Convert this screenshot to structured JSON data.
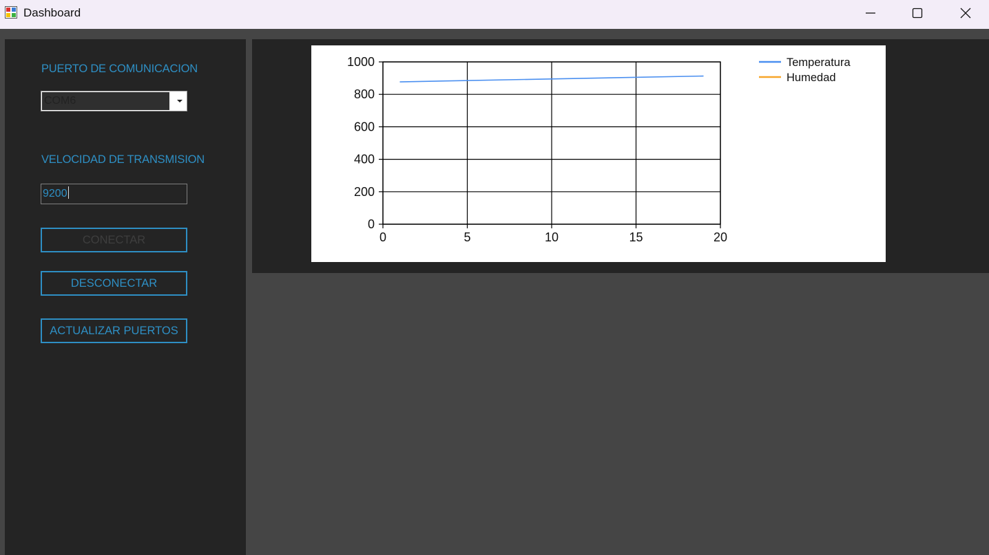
{
  "window": {
    "title": "Dashboard"
  },
  "sidebar": {
    "port_label": "PUERTO DE COMUNICACION",
    "port_value": "COM6",
    "speed_label": "VELOCIDAD DE TRANSMISION",
    "speed_value": "9200",
    "connect_label": "CONECTAR",
    "disconnect_label": "DESCONECTAR",
    "refresh_label": "ACTUALIZAR PUERTOS"
  },
  "colors": {
    "accent": "#2e8fc4",
    "temperature": "#4a8ff0",
    "humidity": "#f7a529"
  },
  "chart_data": {
    "type": "line",
    "xlim": [
      0,
      20
    ],
    "ylim": [
      0,
      1000
    ],
    "xticks": [
      "0",
      "5",
      "10",
      "15",
      "20"
    ],
    "yticks": [
      "0",
      "200",
      "400",
      "600",
      "800",
      "1000"
    ],
    "grid": true,
    "legend_position": "top-right",
    "series": [
      {
        "name": "Temperatura",
        "x": [
          1,
          19
        ],
        "y": [
          877,
          913
        ]
      },
      {
        "name": "Humedad",
        "x": [],
        "y": []
      }
    ]
  }
}
